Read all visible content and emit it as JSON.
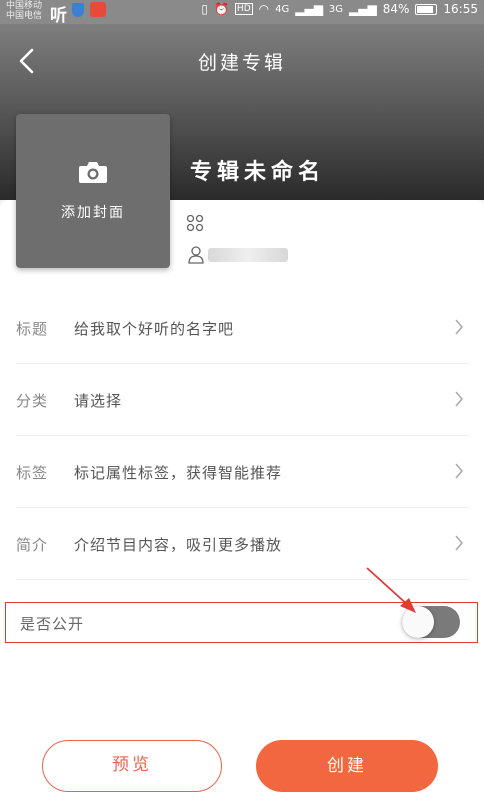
{
  "status_bar": {
    "carrier_1": "中国移动",
    "carrier_2": "中国电信",
    "app_glyph": "听",
    "network_1": "4G",
    "network_2": "3G",
    "hd": "HD",
    "battery": "84%",
    "time": "16:55"
  },
  "header": {
    "title": "创建专辑",
    "album_name": "专辑未命名"
  },
  "cover": {
    "label": "添加封面"
  },
  "form": {
    "rows": [
      {
        "label": "标题",
        "value": "给我取个好听的名字吧"
      },
      {
        "label": "分类",
        "value": "请选择"
      },
      {
        "label": "标签",
        "value": "标记属性标签，获得智能推荐"
      },
      {
        "label": "简介",
        "value": "介绍节目内容，吸引更多播放"
      }
    ],
    "public_label": "是否公开",
    "public_enabled": false
  },
  "buttons": {
    "preview": "预览",
    "create": "创建"
  },
  "colors": {
    "accent": "#f2673f",
    "highlight_box": "#e23a3a"
  }
}
